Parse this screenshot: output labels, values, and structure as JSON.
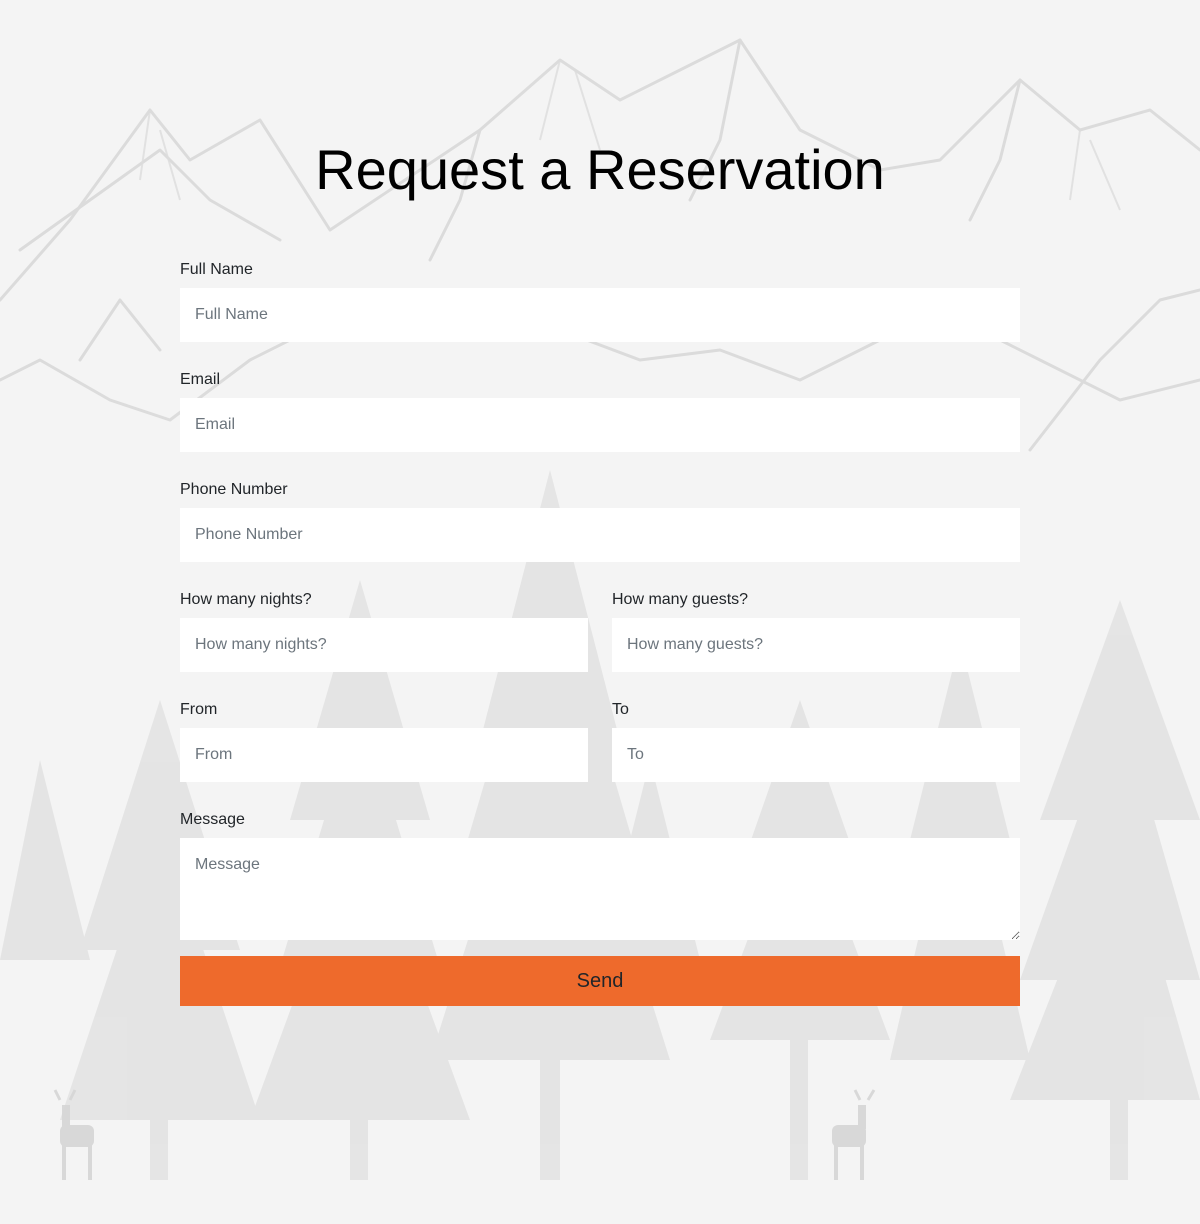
{
  "page": {
    "title": "Request a Reservation"
  },
  "form": {
    "full_name": {
      "label": "Full Name",
      "placeholder": "Full Name",
      "value": ""
    },
    "email": {
      "label": "Email",
      "placeholder": "Email",
      "value": ""
    },
    "phone": {
      "label": "Phone Number",
      "placeholder": "Phone Number",
      "value": ""
    },
    "nights": {
      "label": "How many nights?",
      "placeholder": "How many nights?",
      "value": ""
    },
    "guests": {
      "label": "How many guests?",
      "placeholder": "How many guests?",
      "value": ""
    },
    "from": {
      "label": "From",
      "placeholder": "From",
      "value": ""
    },
    "to": {
      "label": "To",
      "placeholder": "To",
      "value": ""
    },
    "message": {
      "label": "Message",
      "placeholder": "Message",
      "value": ""
    },
    "submit_label": "Send"
  },
  "colors": {
    "background": "#f4f4f4",
    "accent": "#ee6a2c",
    "sketch": "#d6d6d6"
  },
  "icons": {
    "background": "mountain-forest-sketch"
  }
}
